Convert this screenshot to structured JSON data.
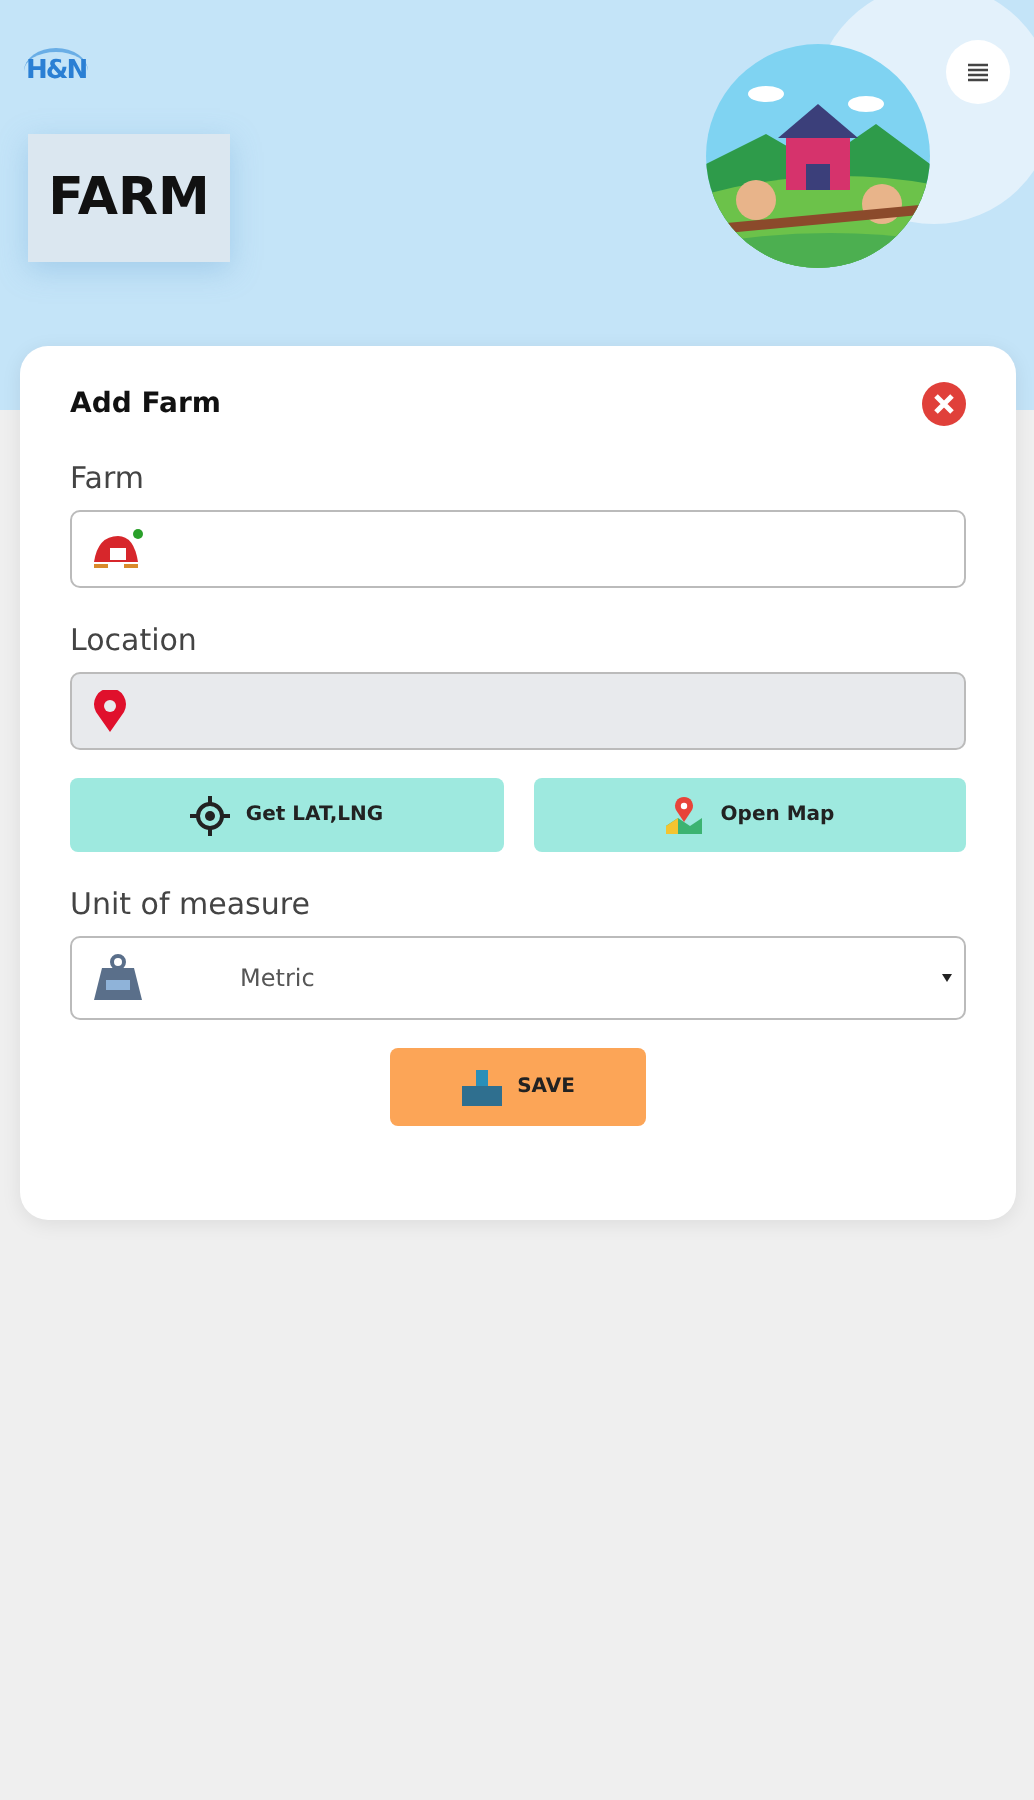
{
  "header": {
    "logo": "H&N",
    "title": "FARM"
  },
  "dialog": {
    "title": "Add Farm",
    "fields": [
      {
        "kind": "farm",
        "label": "Farm",
        "disabled": false
      },
      {
        "kind": "location",
        "label": "Location",
        "disabled": true
      }
    ],
    "buttons": [
      {
        "kind": "target",
        "label": "Get LAT,LNG"
      },
      {
        "kind": "map",
        "label": "Open Map"
      }
    ],
    "unit": {
      "label": "Unit of measure",
      "value": "Metric"
    },
    "save": "SAVE"
  }
}
